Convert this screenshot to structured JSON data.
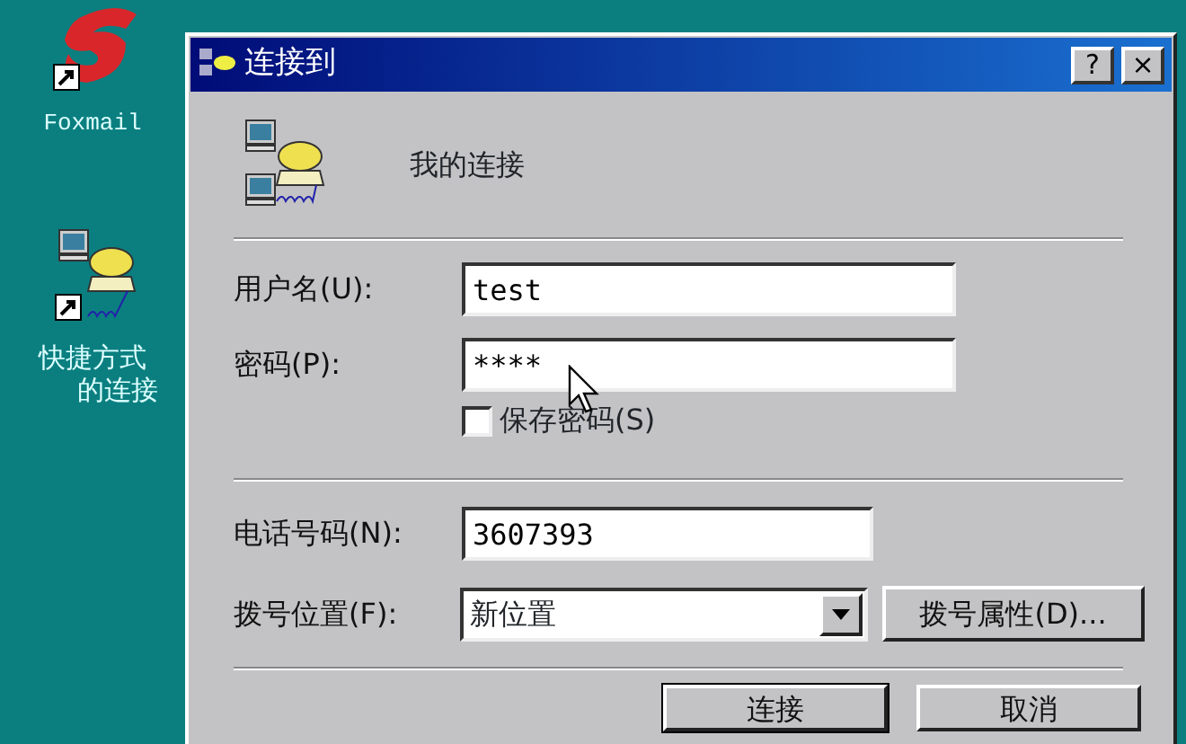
{
  "desktop_icons": [
    {
      "kind": "foxmail",
      "label_lines": [
        "Foxmail"
      ]
    },
    {
      "kind": "dialup",
      "label_lines": [
        "快捷方式",
        "的连接"
      ]
    }
  ],
  "dialog": {
    "title": "连接到",
    "title_buttons": [
      "?",
      "×"
    ],
    "connection_name": "我的连接",
    "fields": [
      {
        "label": "用户名(U):",
        "value": "test"
      },
      {
        "label": "密码(P):",
        "value": "****"
      }
    ],
    "save_password": {
      "label": "保存密码(S)",
      "checked": false
    },
    "phone": {
      "label": "电话号码(N):",
      "value": "3607393"
    },
    "dial_from": {
      "label": "拨号位置(F):",
      "value": "新位置",
      "button": "拨号属性(D)..."
    },
    "buttons": [
      "连接",
      "取消"
    ]
  }
}
